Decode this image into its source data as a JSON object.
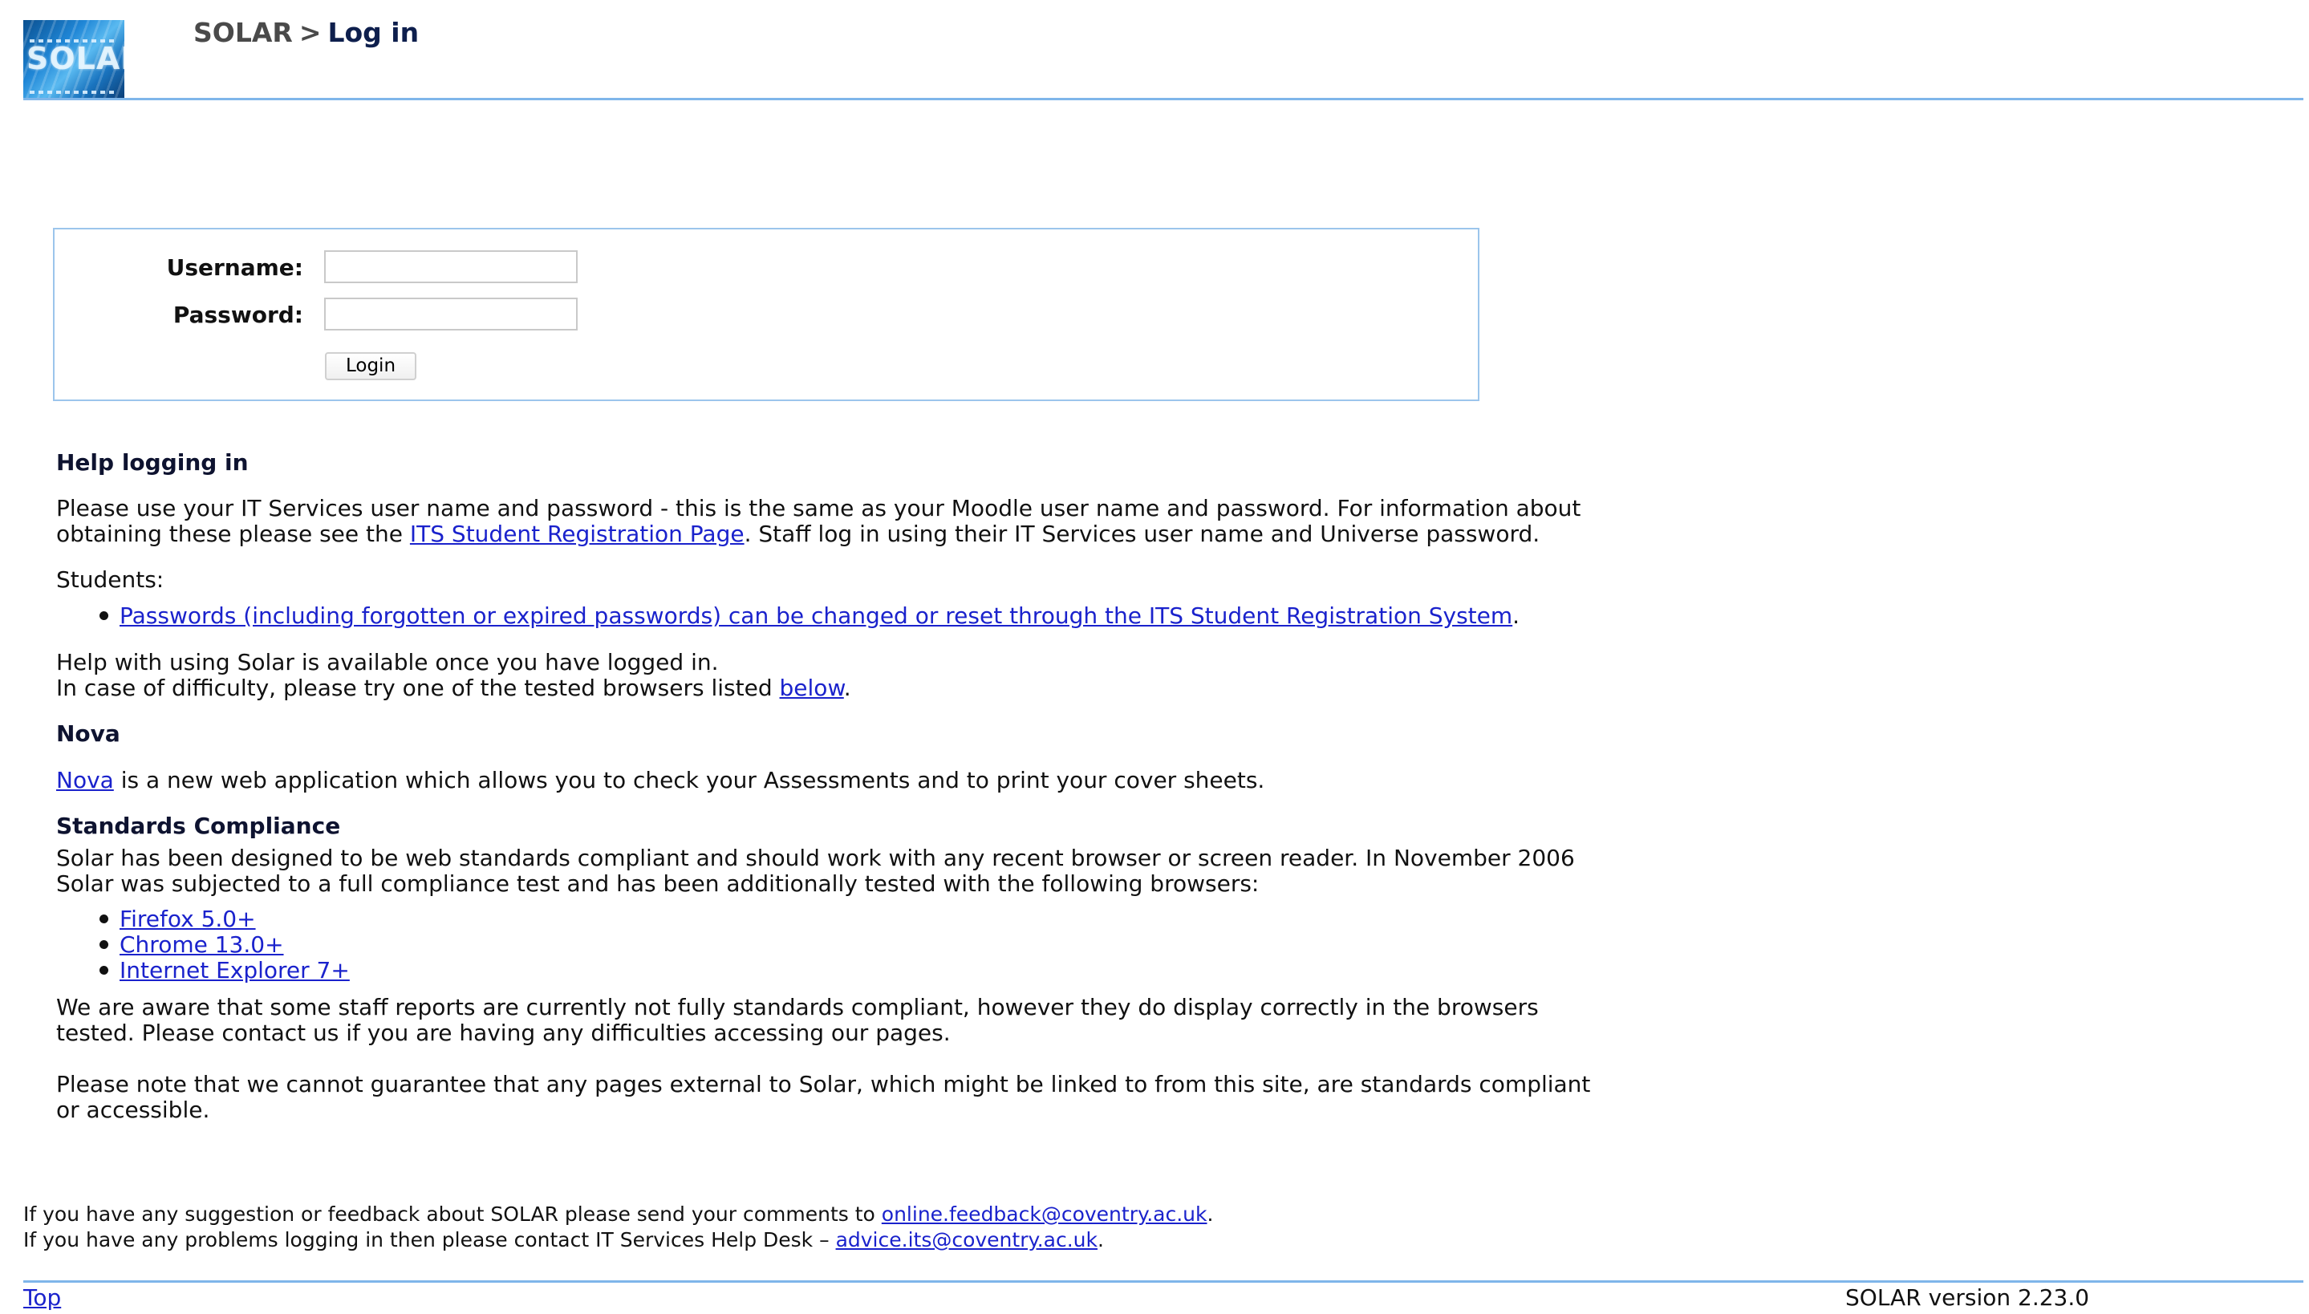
{
  "header": {
    "logo_text": "SOLAR",
    "breadcrumb_root": "SOLAR",
    "breadcrumb_separator": ">",
    "page_title": "Log in"
  },
  "login_form": {
    "username_label": "Username:",
    "password_label": "Password:",
    "username_value": "",
    "password_value": "",
    "login_button": "Login"
  },
  "help": {
    "heading": "Help logging in",
    "para1_line1": "Please use your IT Services user name and password - this is the same as your Moodle user name and password. For information about",
    "para1_line2_pre": "obtaining these please see the ",
    "para1_link": "ITS Student Registration Page",
    "para1_line2_post": ". Staff log in using their IT Services user name and Universe password.",
    "students_label": "Students:",
    "students_item_link": "Passwords (including forgotten or expired passwords) can be changed or reset through the ITS Student Registration System",
    "students_item_post": ".",
    "para2_line1": "Help with using Solar is available once you have logged in.",
    "para2_line2_pre": "In case of difficulty, please try one of the tested browsers listed ",
    "para2_link": "below",
    "para2_line2_post": "."
  },
  "nova": {
    "heading": "Nova",
    "link": "Nova",
    "text": " is a new web application which allows you to check your Assessments and to print your cover sheets."
  },
  "standards": {
    "heading": "Standards Compliance",
    "line1": "Solar has been designed to be web standards compliant and should work with any recent browser or screen reader. In November 2006",
    "line2": "Solar was subjected to a full compliance test and has been additionally tested with the following browsers:",
    "browsers": [
      "Firefox 5.0+",
      "Chrome 13.0+",
      "Internet Explorer 7+"
    ],
    "para2_line1": "We are aware that some staff reports are currently not fully standards compliant, however they do display correctly in the browsers",
    "para2_line2": "tested. Please contact us if you are having any difficulties accessing our pages.",
    "para3_line1": "Please note that we cannot guarantee that any pages external to Solar, which might be linked to from this site, are standards compliant",
    "para3_line2": "or accessible."
  },
  "footer": {
    "feedback_pre": "If you have any suggestion or feedback about SOLAR please send your comments to ",
    "feedback_email": "online.feedback@coventry.ac.uk",
    "feedback_post": ".",
    "helpdesk_pre": "If you have any problems logging in then please contact IT Services Help Desk – ",
    "helpdesk_email": "advice.its@coventry.ac.uk",
    "helpdesk_post": ".",
    "top_link": "Top",
    "version": "SOLAR version 2.23.0"
  },
  "colors": {
    "rule": "#7fb6ea",
    "login_box_border": "#9cc5ec",
    "link": "#1a22cc"
  }
}
